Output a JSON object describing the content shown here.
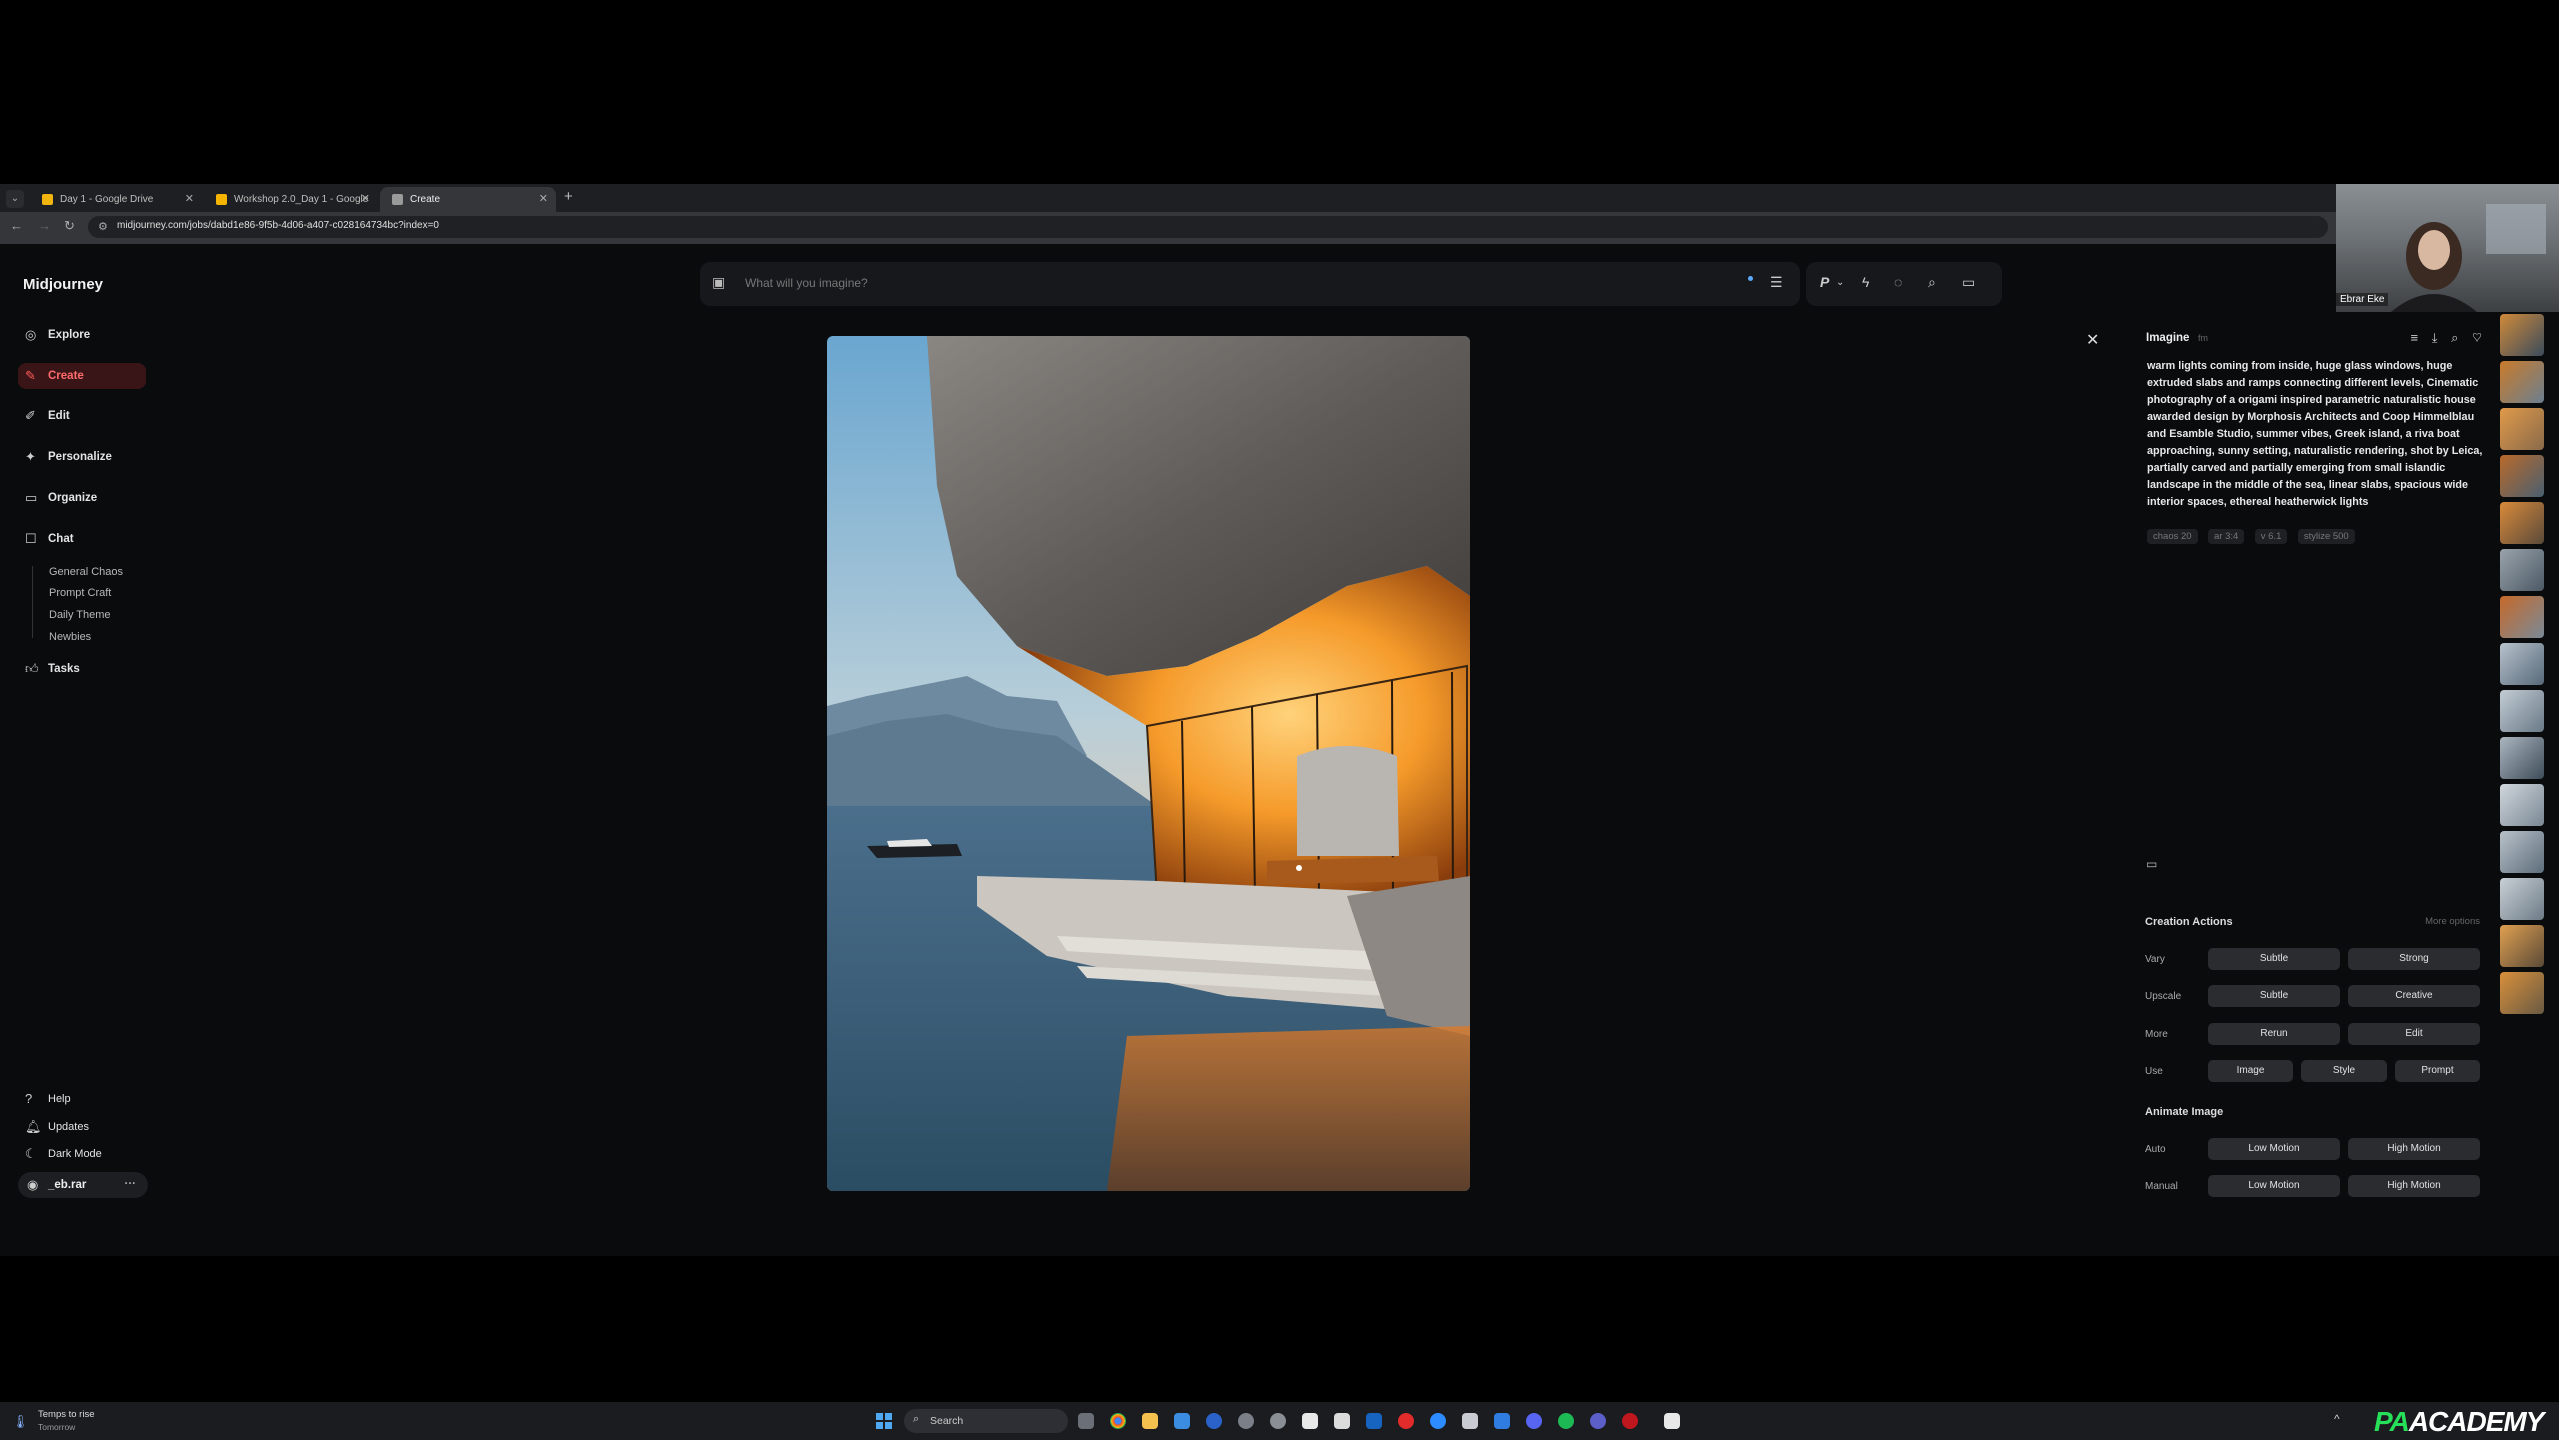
{
  "browser": {
    "tabs": [
      {
        "title": "Day 1 - Google Drive",
        "color": "#f2b50f"
      },
      {
        "title": "Workshop 2.0_Day 1 - Google",
        "color": "#f4b400"
      },
      {
        "title": "Create",
        "color": "#9a9a9a"
      }
    ],
    "new_tab": "+",
    "url": "midjourney.com/jobs/dabd1e86-9f5b-4d06-a407-c028164734bc?index=0"
  },
  "sidebar": {
    "logo": "Midjourney",
    "nav": [
      {
        "label": "Explore",
        "icon": "compass-icon"
      },
      {
        "label": "Create",
        "icon": "brush-icon",
        "active": true
      },
      {
        "label": "Edit",
        "icon": "pencil-icon"
      },
      {
        "label": "Personalize",
        "icon": "sparkle-icon"
      },
      {
        "label": "Organize",
        "icon": "folder-icon"
      },
      {
        "label": "Chat",
        "icon": "chat-icon"
      }
    ],
    "chat_rooms": [
      "General Chaos",
      "Prompt Craft",
      "Daily Theme",
      "Newbies"
    ],
    "tasks": "Tasks",
    "bottom": [
      {
        "label": "Help",
        "icon": "help-icon"
      },
      {
        "label": "Updates",
        "icon": "bell-icon"
      },
      {
        "label": "Dark Mode",
        "icon": "moon-icon"
      }
    ],
    "user": "_eb.rar",
    "user_more": "···"
  },
  "prompt_bar": {
    "placeholder": "What will you imagine?"
  },
  "panel": {
    "header": "Imagine",
    "header_tag": "fm",
    "prompt": "warm lights coming from inside, huge glass windows, huge extruded slabs and ramps connecting different levels, Cinematic photography of a origami inspired parametric naturalistic house awarded design by Morphosis Architects and Coop Himmelblau and Esamble Studio, summer vibes, Greek island, a riva boat approaching, sunny setting, naturalistic rendering, shot by Leica, partially carved and partially emerging from small islandic landscape in the middle of the sea, linear slabs, spacious wide interior spaces, ethereal heatherwick lights",
    "params": [
      "chaos 20",
      "ar 3:4",
      "v 6.1",
      "stylize 500"
    ],
    "creation_actions": "Creation Actions",
    "more_options": "More options",
    "rows": [
      {
        "label": "Vary",
        "buttons": [
          "Subtle",
          "Strong"
        ]
      },
      {
        "label": "Upscale",
        "buttons": [
          "Subtle",
          "Creative"
        ]
      },
      {
        "label": "More",
        "buttons": [
          "Rerun",
          "Edit"
        ]
      },
      {
        "label": "Use",
        "buttons": [
          "Image",
          "Style",
          "Prompt"
        ]
      }
    ],
    "animate_title": "Animate Image",
    "animate_rows": [
      {
        "label": "Auto",
        "buttons": [
          "Low Motion",
          "High Motion"
        ]
      },
      {
        "label": "Manual",
        "buttons": [
          "Low Motion",
          "High Motion"
        ]
      }
    ]
  },
  "webcam": {
    "name": "Ebrar Eke"
  },
  "taskbar": {
    "weather_line1": "Temps to rise",
    "weather_line2": "Tomorrow",
    "search": "Search",
    "brand_pa": "PA",
    "brand_rest": "ACADEMY"
  },
  "colors": {
    "accent_red": "#ff5a5a",
    "background": "#0a0b0d",
    "brand_green": "#27e05a"
  }
}
